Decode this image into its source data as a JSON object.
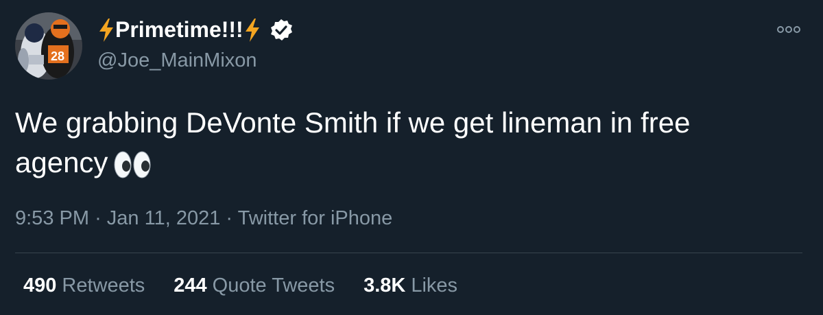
{
  "user": {
    "display_name": "Primetime!!!",
    "handle": "@Joe_MainMixon",
    "verified": true,
    "avatar_icon": "football-player-avatar",
    "name_decoration_icon": "lightning-bolt-emoji"
  },
  "tweet": {
    "text": "We grabbing DeVonte Smith if we get lineman in free agency",
    "emoji": "eyes-emoji"
  },
  "meta": {
    "time": "9:53 PM",
    "separator": "·",
    "date": "Jan 11, 2021",
    "source": "Twitter for iPhone"
  },
  "stats": {
    "retweets": {
      "count": "490",
      "label": "Retweets"
    },
    "quotes": {
      "count": "244",
      "label": "Quote Tweets"
    },
    "likes": {
      "count": "3.8K",
      "label": "Likes"
    }
  },
  "colors": {
    "background": "#15202b",
    "primary_text": "#ffffff",
    "secondary_text": "#8899a6",
    "divider": "#38444d",
    "bolt": "#f4a521"
  }
}
